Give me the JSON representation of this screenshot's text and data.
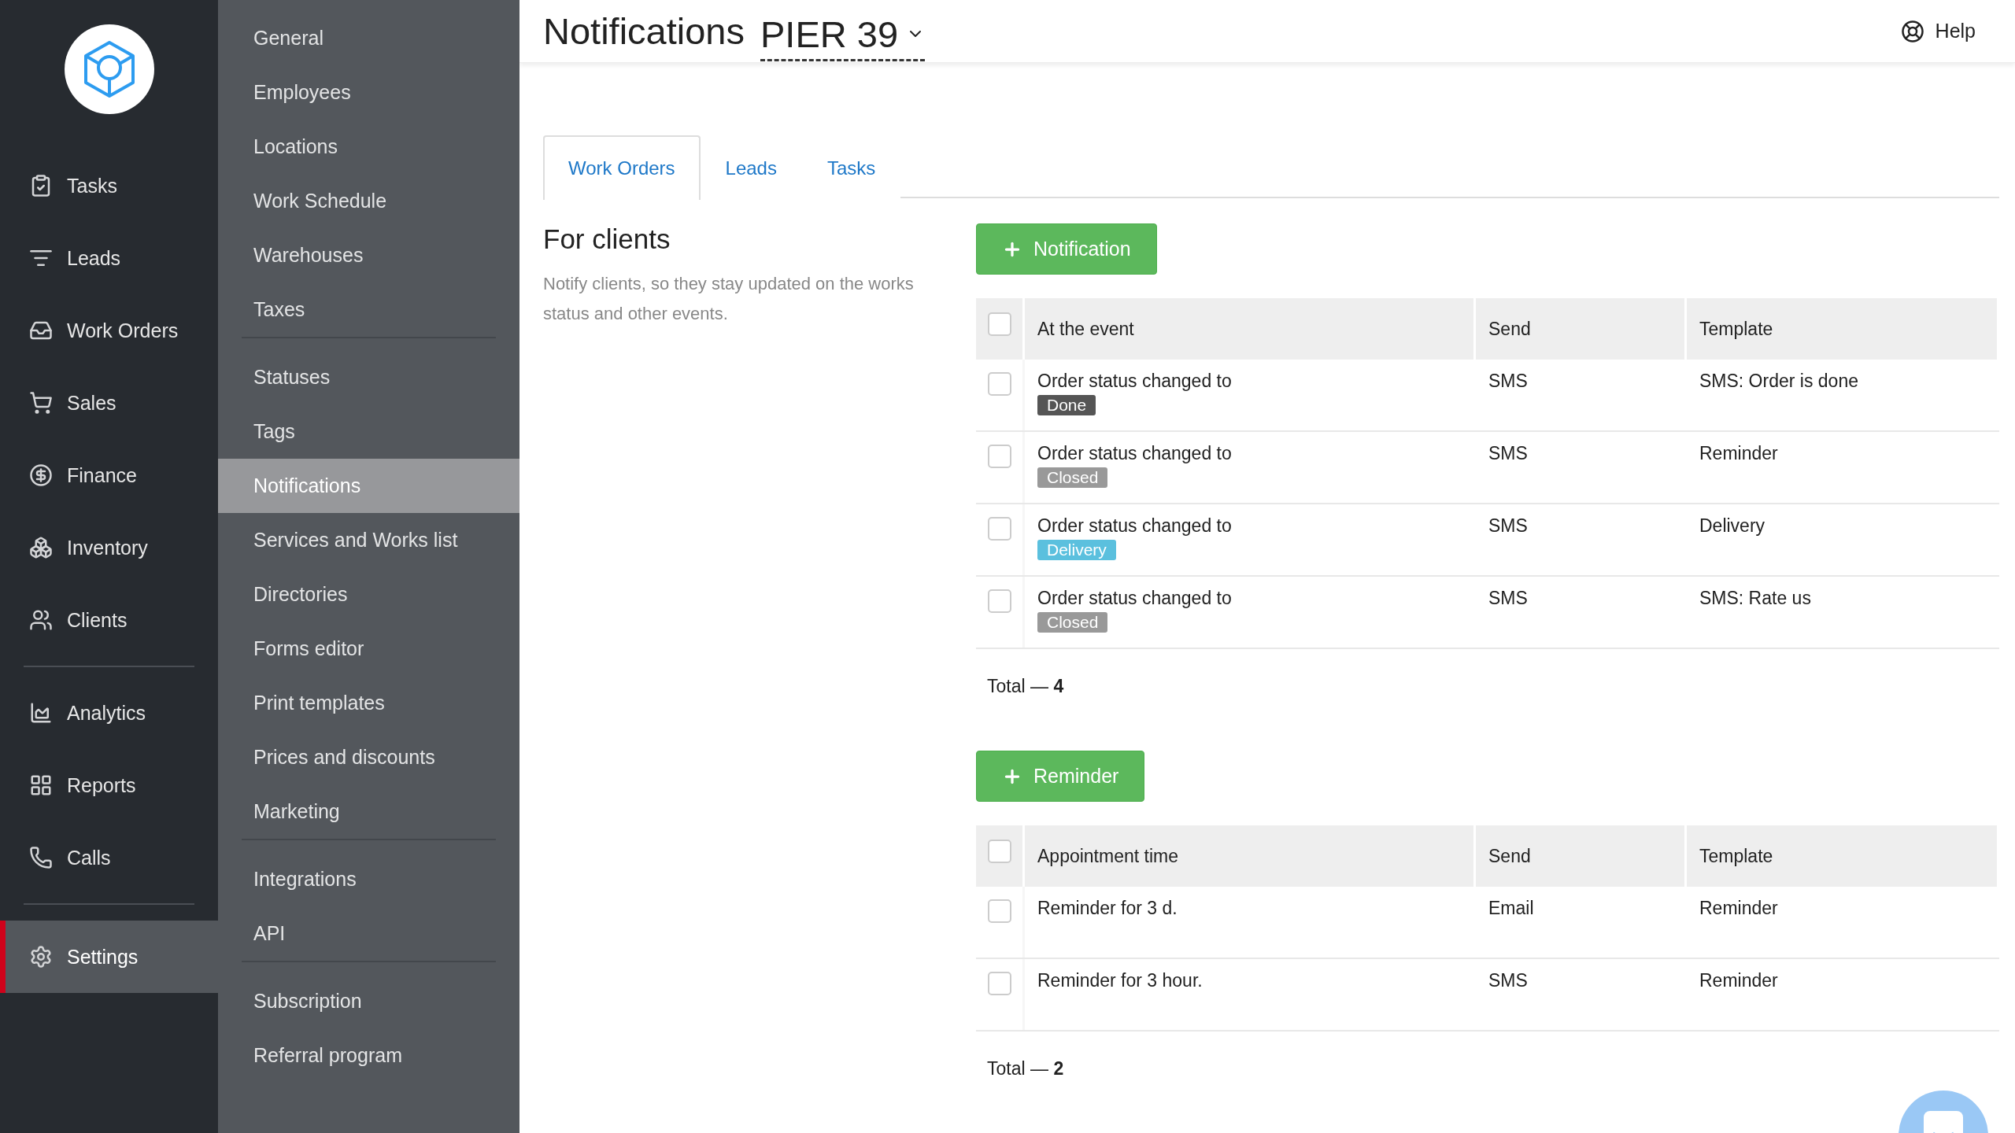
{
  "nav": {
    "groups": [
      [
        {
          "label": "Tasks",
          "selected": false
        },
        {
          "label": "Leads",
          "selected": false
        },
        {
          "label": "Work Orders",
          "selected": false
        },
        {
          "label": "Sales",
          "selected": false
        },
        {
          "label": "Finance",
          "selected": false
        },
        {
          "label": "Inventory",
          "selected": false
        },
        {
          "label": "Clients",
          "selected": false
        }
      ],
      [
        {
          "label": "Analytics",
          "selected": false
        },
        {
          "label": "Reports",
          "selected": false
        },
        {
          "label": "Calls",
          "selected": false
        }
      ],
      [
        {
          "label": "Settings",
          "selected": true
        }
      ]
    ]
  },
  "settings_menu": {
    "groups": [
      [
        {
          "label": "General",
          "selected": false
        },
        {
          "label": "Employees",
          "selected": false
        },
        {
          "label": "Locations",
          "selected": false
        },
        {
          "label": "Work Schedule",
          "selected": false
        },
        {
          "label": "Warehouses",
          "selected": false
        },
        {
          "label": "Taxes",
          "selected": false
        }
      ],
      [
        {
          "label": "Statuses",
          "selected": false
        },
        {
          "label": "Tags",
          "selected": false
        },
        {
          "label": "Notifications",
          "selected": true
        },
        {
          "label": "Services and Works list",
          "selected": false
        },
        {
          "label": "Directories",
          "selected": false
        },
        {
          "label": "Forms editor",
          "selected": false
        },
        {
          "label": "Print templates",
          "selected": false
        },
        {
          "label": "Prices and discounts",
          "selected": false
        },
        {
          "label": "Marketing",
          "selected": false
        }
      ],
      [
        {
          "label": "Integrations",
          "selected": false
        },
        {
          "label": "API",
          "selected": false
        }
      ],
      [
        {
          "label": "Subscription",
          "selected": false
        },
        {
          "label": "Referral program",
          "selected": false
        }
      ]
    ]
  },
  "header": {
    "title": "Notifications",
    "location": "PIER 39",
    "help": "Help"
  },
  "tabs": [
    {
      "label": "Work Orders",
      "selected": true
    },
    {
      "label": "Leads",
      "selected": false
    },
    {
      "label": "Tasks",
      "selected": false
    }
  ],
  "section": {
    "title": "For clients",
    "description": "Notify clients, so they stay updated on the works status and other events."
  },
  "tables": [
    {
      "button": "Notification",
      "columns": [
        "At the event",
        "Send",
        "Template"
      ],
      "header_checked": false,
      "rows": [
        {
          "checked": false,
          "event": "Order status changed to",
          "status": {
            "label": "Done",
            "color": "#555555"
          },
          "send": "SMS",
          "template": "SMS: Order is done"
        },
        {
          "checked": false,
          "event": "Order status changed to",
          "status": {
            "label": "Closed",
            "color": "#999999"
          },
          "send": "SMS",
          "template": "Reminder"
        },
        {
          "checked": false,
          "event": "Order status changed to",
          "status": {
            "label": "Delivery",
            "color": "#5bc0de"
          },
          "send": "SMS",
          "template": "Delivery"
        },
        {
          "checked": false,
          "event": "Order status changed to",
          "status": {
            "label": "Closed",
            "color": "#999999"
          },
          "send": "SMS",
          "template": "SMS: Rate us"
        }
      ],
      "total": "Total — **4**"
    },
    {
      "button": "Reminder",
      "columns": [
        "Appointment time",
        "Send",
        "Template"
      ],
      "header_checked": false,
      "rows": [
        {
          "checked": false,
          "event": "Reminder for 3 d.",
          "send": "Email",
          "template": "Reminder"
        },
        {
          "checked": false,
          "event": "Reminder for 3 hour.",
          "send": "SMS",
          "template": "Reminder"
        }
      ],
      "total": "Total — **2**"
    }
  ]
}
